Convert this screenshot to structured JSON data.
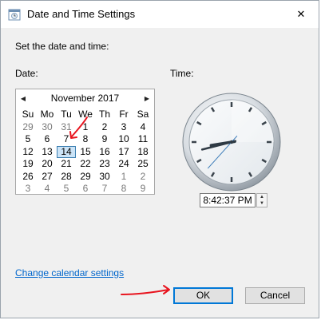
{
  "window": {
    "title": "Date and Time Settings",
    "close_glyph": "✕"
  },
  "instruction": "Set the date and time:",
  "date_label": "Date:",
  "time_label": "Time:",
  "calendar": {
    "month_year": "November 2017",
    "prev_glyph": "◀",
    "next_glyph": "▶",
    "weekdays": [
      "Su",
      "Mo",
      "Tu",
      "We",
      "Th",
      "Fr",
      "Sa"
    ],
    "weeks": [
      [
        {
          "d": "29",
          "other": true
        },
        {
          "d": "30",
          "other": true
        },
        {
          "d": "31",
          "other": true
        },
        {
          "d": "1"
        },
        {
          "d": "2"
        },
        {
          "d": "3"
        },
        {
          "d": "4"
        }
      ],
      [
        {
          "d": "5"
        },
        {
          "d": "6"
        },
        {
          "d": "7"
        },
        {
          "d": "8"
        },
        {
          "d": "9"
        },
        {
          "d": "10"
        },
        {
          "d": "11"
        }
      ],
      [
        {
          "d": "12"
        },
        {
          "d": "13"
        },
        {
          "d": "14",
          "selected": true
        },
        {
          "d": "15"
        },
        {
          "d": "16"
        },
        {
          "d": "17"
        },
        {
          "d": "18"
        }
      ],
      [
        {
          "d": "19"
        },
        {
          "d": "20"
        },
        {
          "d": "21"
        },
        {
          "d": "22"
        },
        {
          "d": "23"
        },
        {
          "d": "24"
        },
        {
          "d": "25"
        }
      ],
      [
        {
          "d": "26"
        },
        {
          "d": "27"
        },
        {
          "d": "28"
        },
        {
          "d": "29"
        },
        {
          "d": "30"
        },
        {
          "d": "1",
          "other": true
        },
        {
          "d": "2",
          "other": true
        }
      ],
      [
        {
          "d": "3",
          "other": true
        },
        {
          "d": "4",
          "other": true
        },
        {
          "d": "5",
          "other": true
        },
        {
          "d": "6",
          "other": true
        },
        {
          "d": "7",
          "other": true
        },
        {
          "d": "8",
          "other": true
        },
        {
          "d": "9",
          "other": true
        }
      ]
    ]
  },
  "clock": {
    "hour": 8,
    "minute": 42,
    "second": 37
  },
  "time_value": "8:42:37 PM",
  "spinner": {
    "up_glyph": "▲",
    "down_glyph": "▼"
  },
  "link_text": "Change calendar settings",
  "buttons": {
    "ok": "OK",
    "cancel": "Cancel"
  },
  "colors": {
    "link": "#0066cc",
    "annotation_red": "#e8141e",
    "selected_day": "#cce4f7",
    "primary_border": "#0078d7"
  }
}
